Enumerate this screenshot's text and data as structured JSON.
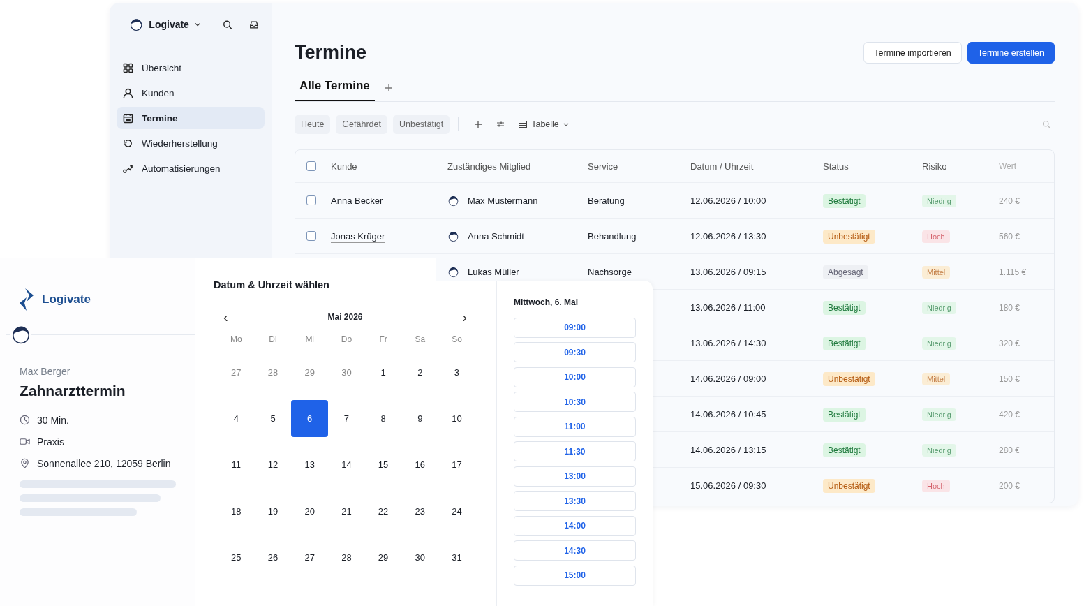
{
  "app": {
    "workspace": "Logivate",
    "nav": [
      {
        "label": "Übersicht",
        "kind": "grid",
        "selected": false
      },
      {
        "label": "Kunden",
        "kind": "user",
        "selected": false
      },
      {
        "label": "Termine",
        "kind": "calendar",
        "selected": true
      },
      {
        "label": "Wiederherstellung",
        "kind": "restore",
        "selected": false
      },
      {
        "label": "Automatisierungen",
        "kind": "flow",
        "selected": false
      }
    ],
    "title": "Termine",
    "actions": [
      {
        "label": "Termine importieren",
        "primary": false
      },
      {
        "label": "Termine erstellen",
        "primary": true
      }
    ],
    "tabs": [
      {
        "label": "Alle Termine",
        "selected": true
      }
    ],
    "filters": [
      "Heute",
      "Gefährdet",
      "Unbestätigt"
    ],
    "view": "Tabelle",
    "table": {
      "all_checked": false,
      "columns": [
        "Kunde",
        "Zuständiges Mitglied",
        "Service",
        "Datum / Uhrzeit",
        "Status",
        "Risiko",
        "Wert"
      ],
      "rows": [
        {
          "checked": false,
          "customer": "Anna Becker",
          "member": "Max Mustermann",
          "service": "Beratung",
          "datetime": "12.06.2026 / 10:00",
          "status": {
            "label": "Bestätigt",
            "kind": "green"
          },
          "risk": {
            "label": "Niedrig",
            "kind": "green"
          },
          "value": "240 €"
        },
        {
          "checked": false,
          "customer": "Jonas Krüger",
          "member": "Anna Schmidt",
          "service": "Behandlung",
          "datetime": "12.06.2026 / 13:30",
          "status": {
            "label": "Unbestätigt",
            "kind": "orange"
          },
          "risk": {
            "label": "Hoch",
            "kind": "red"
          },
          "value": "560 €"
        },
        {
          "member": "Lukas Müller",
          "service": "Nachsorge",
          "datetime": "13.06.2026 / 09:15",
          "status": {
            "label": "Abgesagt",
            "kind": "grey"
          },
          "risk": {
            "label": "Mittel",
            "kind": "orange"
          },
          "value": "1.115 €"
        },
        {
          "datetime": "13.06.2026 / 11:00",
          "status": {
            "label": "Bestätigt",
            "kind": "green"
          },
          "risk": {
            "label": "Niedrig",
            "kind": "green"
          },
          "value": "180 €"
        },
        {
          "datetime": "13.06.2026 / 14:30",
          "status": {
            "label": "Bestätigt",
            "kind": "green"
          },
          "risk": {
            "label": "Niedrig",
            "kind": "green"
          },
          "value": "320 €"
        },
        {
          "datetime": "14.06.2026 / 09:00",
          "status": {
            "label": "Unbestätigt",
            "kind": "orange"
          },
          "risk": {
            "label": "Mittel",
            "kind": "orange"
          },
          "value": "150 €"
        },
        {
          "datetime": "14.06.2026 / 10:45",
          "status": {
            "label": "Bestätigt",
            "kind": "green"
          },
          "risk": {
            "label": "Niedrig",
            "kind": "green"
          },
          "value": "420 €"
        },
        {
          "datetime": "14.06.2026 / 13:15",
          "status": {
            "label": "Bestätigt",
            "kind": "green"
          },
          "risk": {
            "label": "Niedrig",
            "kind": "green"
          },
          "value": "280 €"
        },
        {
          "datetime": "15.06.2026 / 09:30",
          "status": {
            "label": "Unbestätigt",
            "kind": "orange"
          },
          "risk": {
            "label": "Hoch",
            "kind": "red"
          },
          "value": "200 €"
        }
      ]
    }
  },
  "booking": {
    "brand": "Logivate",
    "host": "Max Berger",
    "event": "Zahnarzttermin",
    "details": [
      {
        "kind": "clock",
        "text": "30 Min."
      },
      {
        "kind": "video",
        "text": "Praxis"
      },
      {
        "kind": "pin",
        "text": "Sonnenallee 210, 12059 Berlin"
      }
    ],
    "heading": "Datum & Uhrzeit wählen",
    "prev": "‹",
    "month": "Mai 2026",
    "next": "›",
    "weekdays": [
      "Mo",
      "Di",
      "Mi",
      "Do",
      "Fr",
      "Sa",
      "So"
    ],
    "days": [
      {
        "label": "27",
        "muted": true,
        "selected": false
      },
      {
        "label": "28",
        "muted": true,
        "selected": false
      },
      {
        "label": "29",
        "muted": true,
        "selected": false
      },
      {
        "label": "30",
        "muted": true,
        "selected": false
      },
      {
        "label": "1",
        "muted": false,
        "selected": false
      },
      {
        "label": "2",
        "muted": false,
        "selected": false
      },
      {
        "label": "3",
        "muted": false,
        "selected": false
      },
      {
        "label": "4",
        "muted": false,
        "selected": false
      },
      {
        "label": "5",
        "muted": false,
        "selected": false
      },
      {
        "label": "6",
        "muted": false,
        "selected": true
      },
      {
        "label": "7",
        "muted": false,
        "selected": false
      },
      {
        "label": "8",
        "muted": false,
        "selected": false
      },
      {
        "label": "9",
        "muted": false,
        "selected": false
      },
      {
        "label": "10",
        "muted": false,
        "selected": false
      },
      {
        "label": "11",
        "muted": false,
        "selected": false
      },
      {
        "label": "12",
        "muted": false,
        "selected": false
      },
      {
        "label": "13",
        "muted": false,
        "selected": false
      },
      {
        "label": "14",
        "muted": false,
        "selected": false
      },
      {
        "label": "15",
        "muted": false,
        "selected": false
      },
      {
        "label": "16",
        "muted": false,
        "selected": false
      },
      {
        "label": "17",
        "muted": false,
        "selected": false
      },
      {
        "label": "18",
        "muted": false,
        "selected": false
      },
      {
        "label": "19",
        "muted": false,
        "selected": false
      },
      {
        "label": "20",
        "muted": false,
        "selected": false
      },
      {
        "label": "21",
        "muted": false,
        "selected": false
      },
      {
        "label": "22",
        "muted": false,
        "selected": false
      },
      {
        "label": "23",
        "muted": false,
        "selected": false
      },
      {
        "label": "24",
        "muted": false,
        "selected": false
      },
      {
        "label": "25",
        "muted": false,
        "selected": false
      },
      {
        "label": "26",
        "muted": false,
        "selected": false
      },
      {
        "label": "27",
        "muted": false,
        "selected": false
      },
      {
        "label": "28",
        "muted": false,
        "selected": false
      },
      {
        "label": "29",
        "muted": false,
        "selected": false
      },
      {
        "label": "30",
        "muted": false,
        "selected": false
      },
      {
        "label": "31",
        "muted": false,
        "selected": false
      }
    ],
    "date": "Mittwoch, 6. Mai",
    "slots": [
      "09:00",
      "09:30",
      "10:00",
      "10:30",
      "11:00",
      "11:30",
      "13:00",
      "13:30",
      "14:00",
      "14:30",
      "15:00"
    ]
  }
}
